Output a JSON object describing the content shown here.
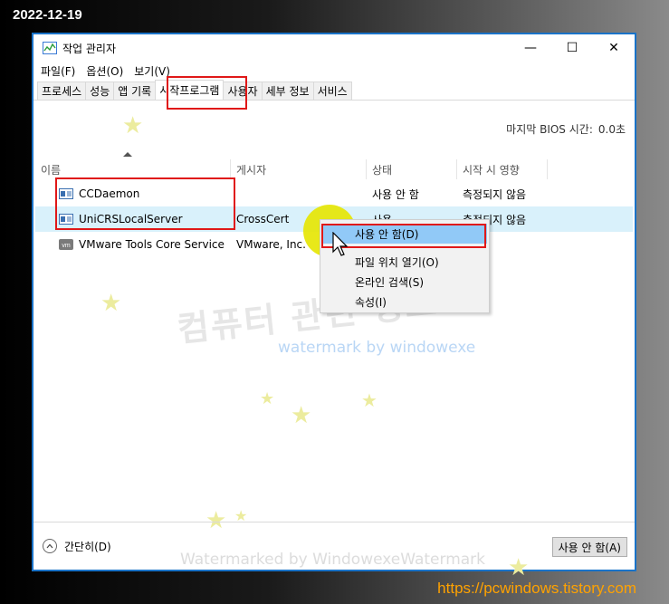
{
  "overlay": {
    "date": "2022-12-19",
    "site_url": "https://pcwindows.tistory.com",
    "watermark_korean": "컴퓨터 관련 정보",
    "watermark_blue": "watermark by windowexe",
    "watermark_bottom": "Watermarked by WindowexeWatermark"
  },
  "window": {
    "title": "작업 관리자",
    "controls": {
      "minimize": "—",
      "maximize": "☐",
      "close": "✕"
    }
  },
  "menu": [
    "파일(F)",
    "옵션(O)",
    "보기(V)"
  ],
  "tabs": [
    {
      "label": "프로세스",
      "active": false
    },
    {
      "label": "성능",
      "active": false
    },
    {
      "label": "앱 기록",
      "active": false
    },
    {
      "label": "시작프로그램",
      "active": true
    },
    {
      "label": "사용자",
      "active": false
    },
    {
      "label": "세부 정보",
      "active": false
    },
    {
      "label": "서비스",
      "active": false
    }
  ],
  "bios": {
    "label": "마지막 BIOS 시간:",
    "value": "0.0초"
  },
  "columns": [
    "이름",
    "게시자",
    "상태",
    "시작 시 영향"
  ],
  "rows": [
    {
      "name": "CCDaemon",
      "publisher": "",
      "status": "사용 안 함",
      "impact": "측정되지 않음",
      "icon": "app-window-icon"
    },
    {
      "name": "UniCRSLocalServer",
      "publisher": "CrossCert",
      "status": "사용",
      "impact": "측정되지 않음",
      "icon": "app-window-icon"
    },
    {
      "name": "VMware Tools Core Service",
      "publisher": "VMware, Inc.",
      "status": "",
      "impact": "",
      "icon": "vmware-icon"
    }
  ],
  "context_menu": [
    "사용 안 함(D)",
    "파일 위치 열기(O)",
    "온라인 검색(S)",
    "속성(I)"
  ],
  "footer": {
    "collapse_label": "간단히(D)",
    "disable_button": "사용 안 함(A)"
  },
  "colors": {
    "accent": "#1a73c8",
    "highlight_red": "#e01818",
    "selected_row": "#d9f1fb",
    "menu_highlight": "#91c9f7",
    "url_orange": "#ffa200"
  }
}
